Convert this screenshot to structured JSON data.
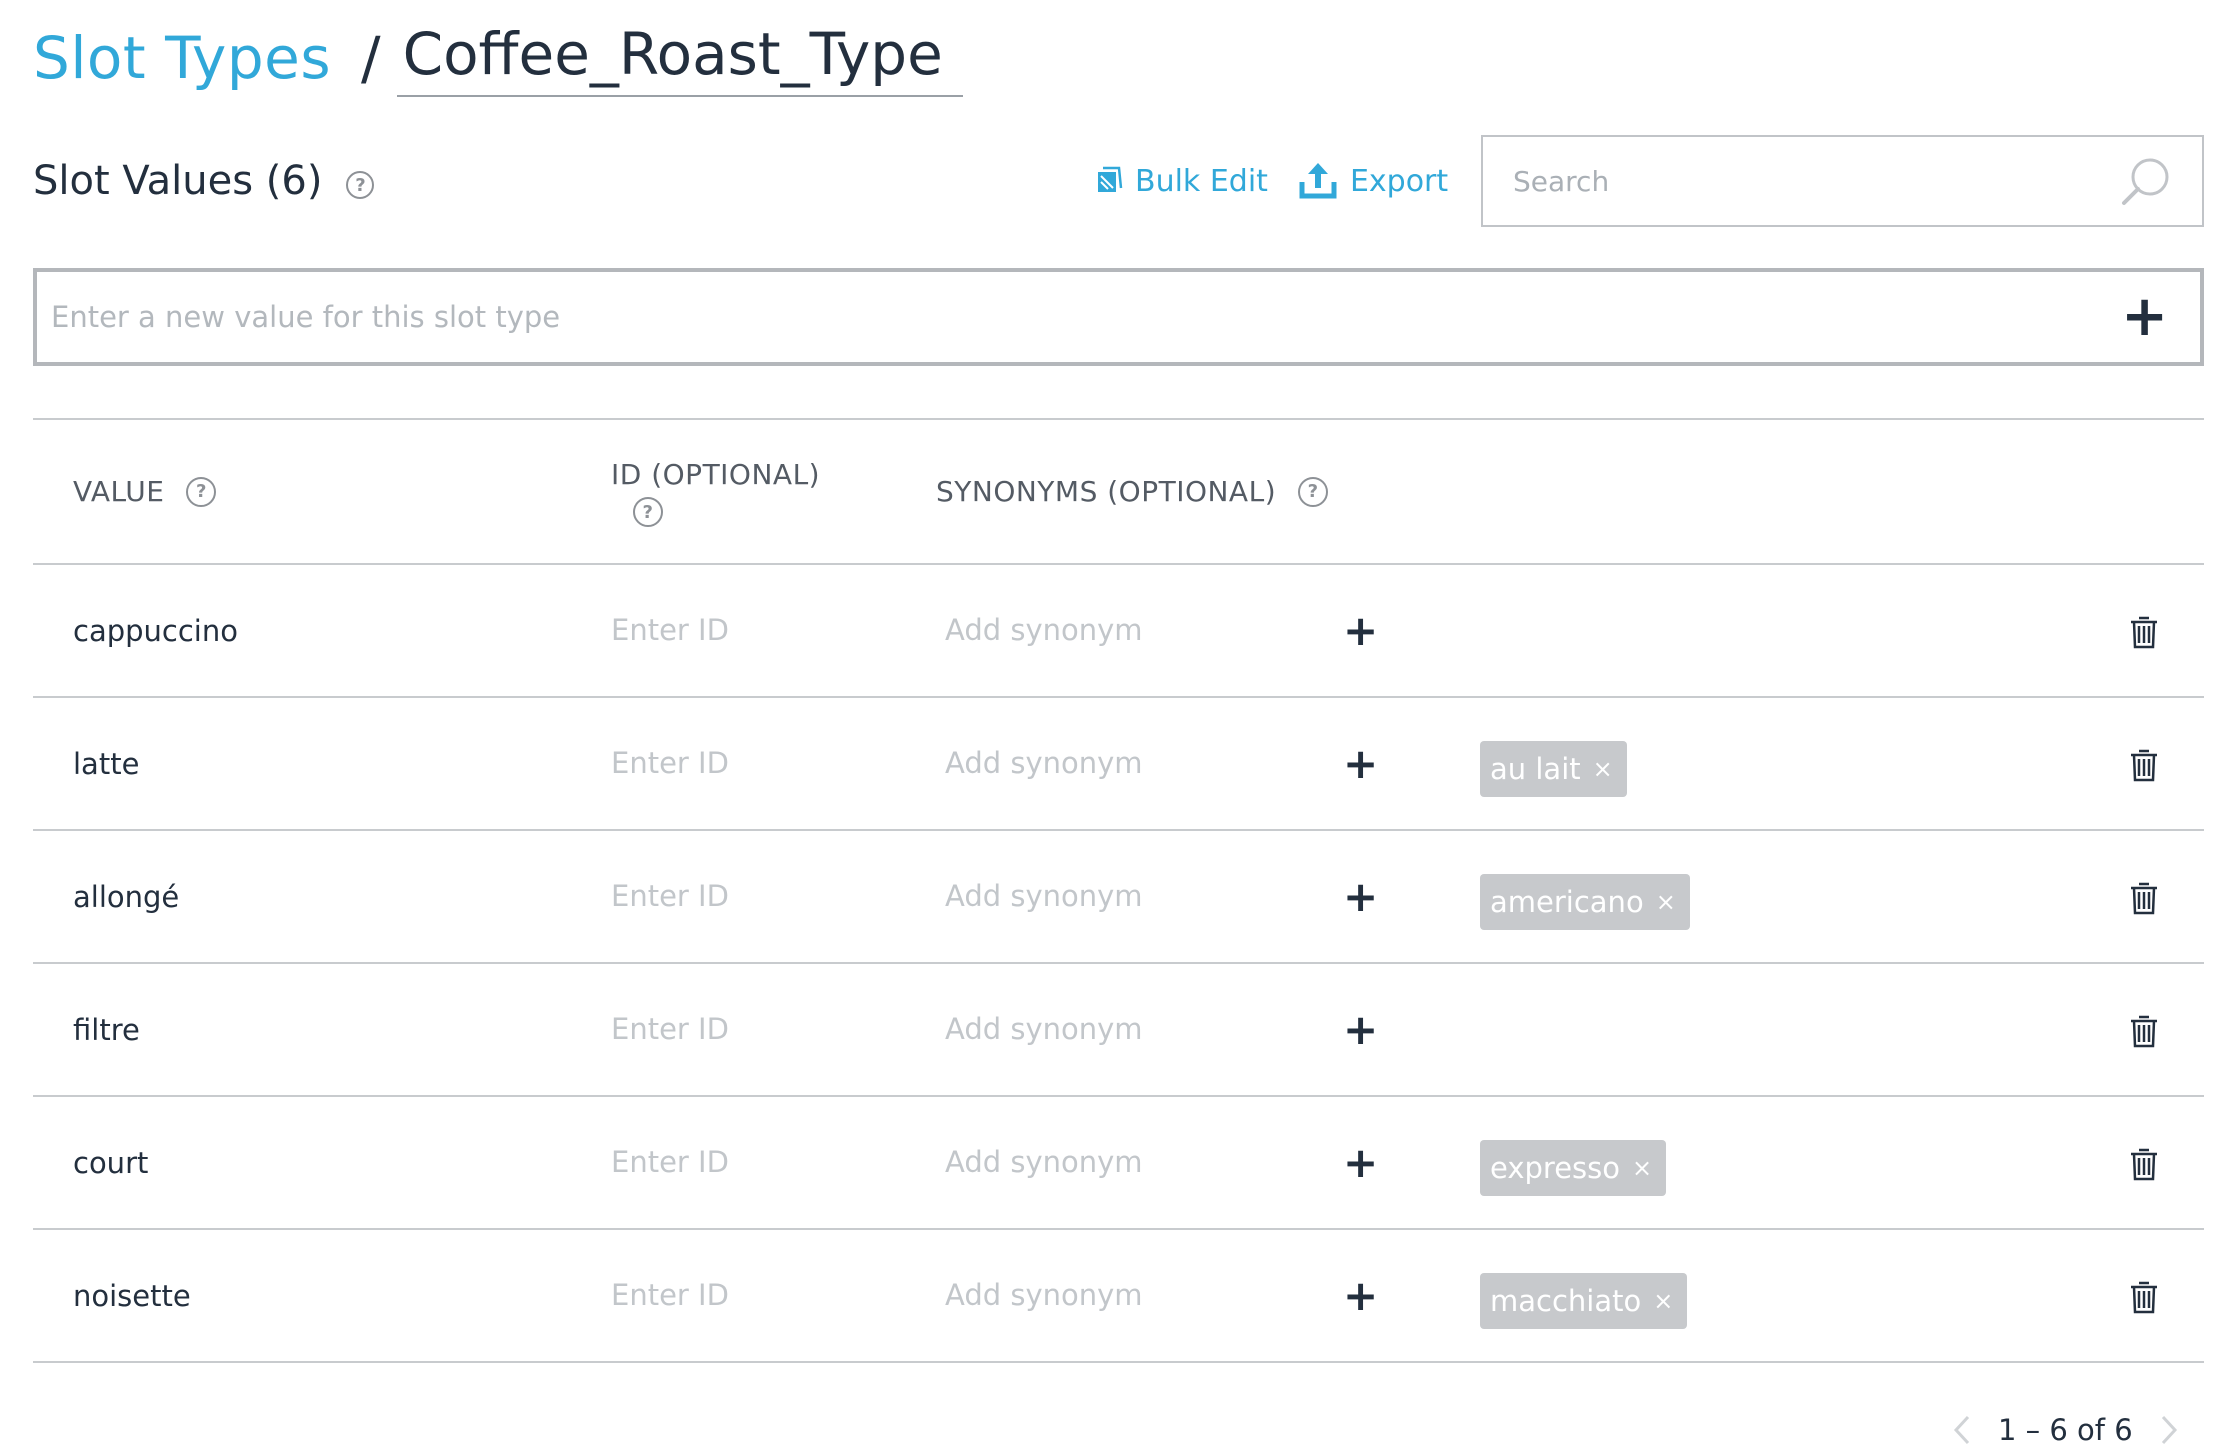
{
  "breadcrumb": {
    "link_label": "Slot Types",
    "separator": "/",
    "slot_type_name": "Coffee_Roast_Type"
  },
  "section": {
    "title": "Slot Values (6)",
    "help": "?"
  },
  "actions": {
    "bulk_edit": "Bulk Edit",
    "export": "Export"
  },
  "search": {
    "placeholder": "Search"
  },
  "new_value": {
    "placeholder": "Enter a new value for this slot type",
    "add_symbol": "+"
  },
  "table": {
    "headers": {
      "value": "VALUE",
      "id": "ID (OPTIONAL)",
      "synonyms": "SYNONYMS (OPTIONAL)",
      "help": "?"
    },
    "id_placeholder": "Enter ID",
    "synonym_placeholder": "Add synonym",
    "add_symbol": "+",
    "chip_remove": "×",
    "rows": [
      {
        "value": "cappuccino",
        "synonyms": []
      },
      {
        "value": "latte",
        "synonyms": [
          "au lait"
        ]
      },
      {
        "value": "allongé",
        "synonyms": [
          "americano"
        ]
      },
      {
        "value": "filtre",
        "synonyms": []
      },
      {
        "value": "court",
        "synonyms": [
          "expresso"
        ]
      },
      {
        "value": "noisette",
        "synonyms": [
          "macchiato"
        ]
      }
    ]
  },
  "pagination": {
    "label": "1 – 6 of 6"
  },
  "colors": {
    "accent": "#31a8d9",
    "text": "#232f3e",
    "chip": "#c7c9cc",
    "border": "#c8cbce"
  }
}
